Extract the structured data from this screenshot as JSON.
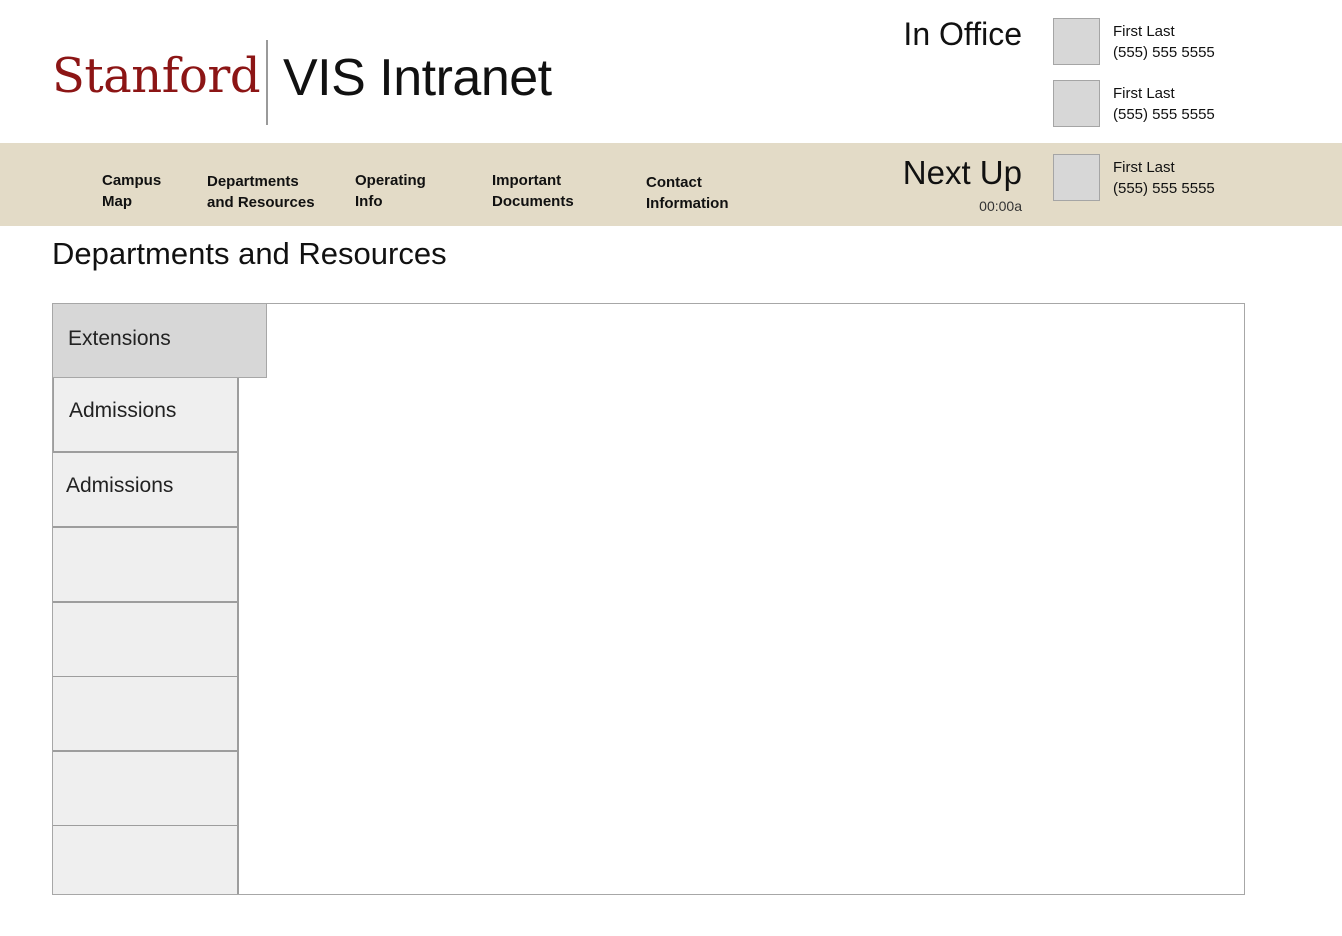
{
  "header": {
    "brand": "Stanford",
    "app_title": "VIS Intranet"
  },
  "status": {
    "in_office_label": "In Office",
    "next_up_label": "Next Up",
    "next_up_time": "00:00a"
  },
  "contacts": [
    {
      "name": "First Last",
      "phone": "(555) 555 5555"
    },
    {
      "name": "First Last",
      "phone": "(555) 555 5555"
    },
    {
      "name": "First Last",
      "phone": "(555) 555 5555"
    }
  ],
  "nav": {
    "items": [
      {
        "line1": "Campus",
        "line2": "Map"
      },
      {
        "line1": "Departments",
        "line2": "and Resources"
      },
      {
        "line1": "Operating",
        "line2": "Info"
      },
      {
        "line1": "Important",
        "line2": "Documents"
      },
      {
        "line1": "Contact",
        "line2": "Information"
      }
    ]
  },
  "page": {
    "title": "Departments and Resources"
  },
  "tabs": [
    {
      "label": "Extensions",
      "active": true
    },
    {
      "label": "Admissions"
    },
    {
      "label": "Admissions"
    },
    {
      "label": ""
    },
    {
      "label": ""
    },
    {
      "label": ""
    },
    {
      "label": ""
    },
    {
      "label": ""
    }
  ],
  "colors": {
    "brand_red": "#8c1515",
    "nav_band": "#e3dbc7",
    "active_tab": "#d7d7d7",
    "tab": "#efefef"
  }
}
